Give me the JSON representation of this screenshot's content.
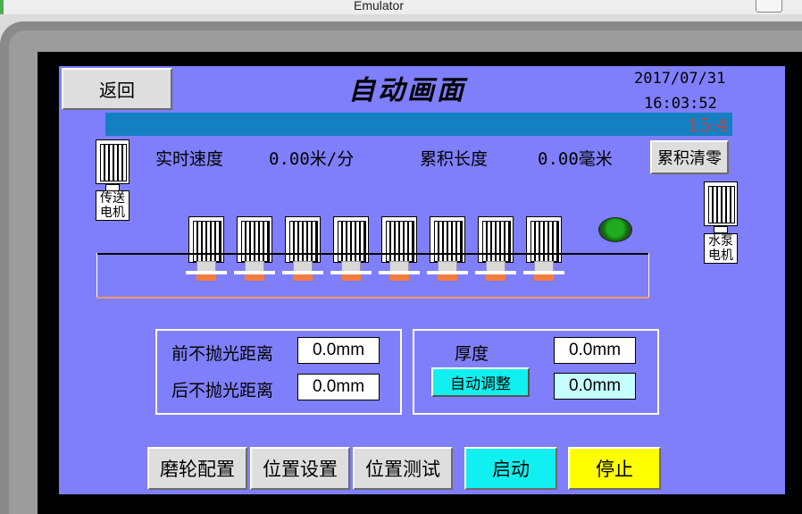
{
  "window": {
    "title": "Emulator"
  },
  "header": {
    "back_label": "返回",
    "title": "自动画面",
    "date": "2017/07/31",
    "time": "16:03:52",
    "scroll_text": "15:4"
  },
  "stats": {
    "speed_label": "实时速度",
    "speed_value": "0.00米/分",
    "length_label": "累积长度",
    "length_value": "0.00毫米",
    "clear_label": "累积清零"
  },
  "motors": {
    "conveyor_label_1": "传送",
    "conveyor_label_2": "电机",
    "pump_label_1": "水泵",
    "pump_label_2": "电机"
  },
  "distance": {
    "front_label": "前不抛光距离",
    "front_value": "0.0mm",
    "rear_label": "后不抛光距离",
    "rear_value": "0.0mm"
  },
  "thickness": {
    "label": "厚度",
    "value": "0.0mm",
    "auto_adjust_label": "自动调整",
    "adjust_value": "0.0mm"
  },
  "bottom_nav": {
    "wheel_config": "磨轮配置",
    "position_setup": "位置设置",
    "position_test": "位置测试",
    "start": "启动",
    "stop": "停止"
  },
  "colors": {
    "screen_bg": "#7f7ffb",
    "accent_bar": "#1480c2",
    "start": "#11f0f0",
    "stop": "#ffff00",
    "indicator": "#1faa1f"
  }
}
